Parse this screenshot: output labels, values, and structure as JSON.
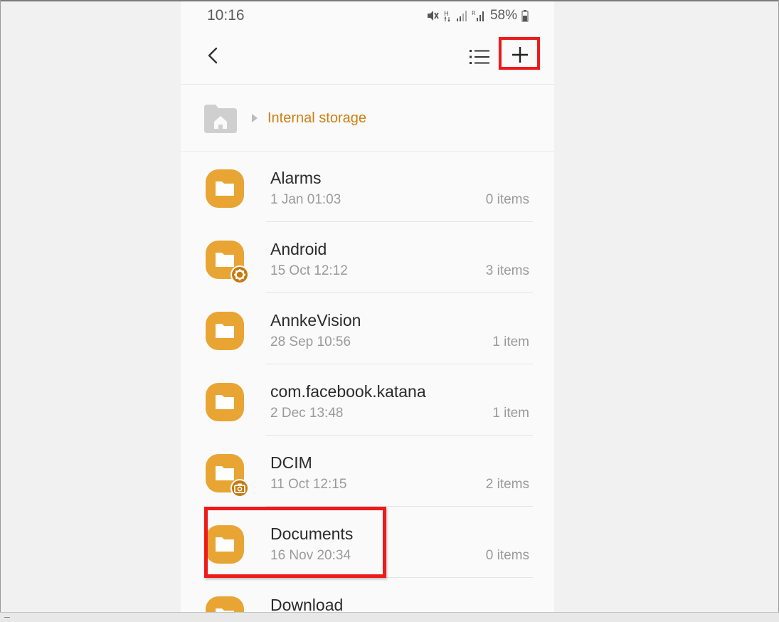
{
  "status_bar": {
    "time": "10:16",
    "battery": "58%",
    "icons": [
      "mute-icon",
      "network-h-icon",
      "signal-icon",
      "signal-roaming-icon",
      "battery-icon"
    ]
  },
  "app_bar": {
    "back_icon": "back-arrow-icon",
    "list_view_icon": "list-view-icon",
    "add_icon": "plus-icon"
  },
  "breadcrumb": {
    "home_icon": "home-folder-icon",
    "current": "Internal storage"
  },
  "folders": [
    {
      "name": "Alarms",
      "date": "1 Jan 01:03",
      "count": "0 items",
      "badge": null
    },
    {
      "name": "Android",
      "date": "15 Oct 12:12",
      "count": "3 items",
      "badge": "gear-icon"
    },
    {
      "name": "AnnkeVision",
      "date": "28 Sep 10:56",
      "count": "1 item",
      "badge": null
    },
    {
      "name": "com.facebook.katana",
      "date": "2 Dec 13:48",
      "count": "1 item",
      "badge": null
    },
    {
      "name": "DCIM",
      "date": "11 Oct 12:15",
      "count": "2 items",
      "badge": "camera-icon"
    },
    {
      "name": "Documents",
      "date": "16 Nov 20:34",
      "count": "0 items",
      "badge": null
    },
    {
      "name": "Download",
      "date": "",
      "count": "",
      "badge": null
    }
  ],
  "colors": {
    "folder": "#e8a534",
    "accent_text": "#cf7e12",
    "highlight": "#ee1b1b"
  }
}
